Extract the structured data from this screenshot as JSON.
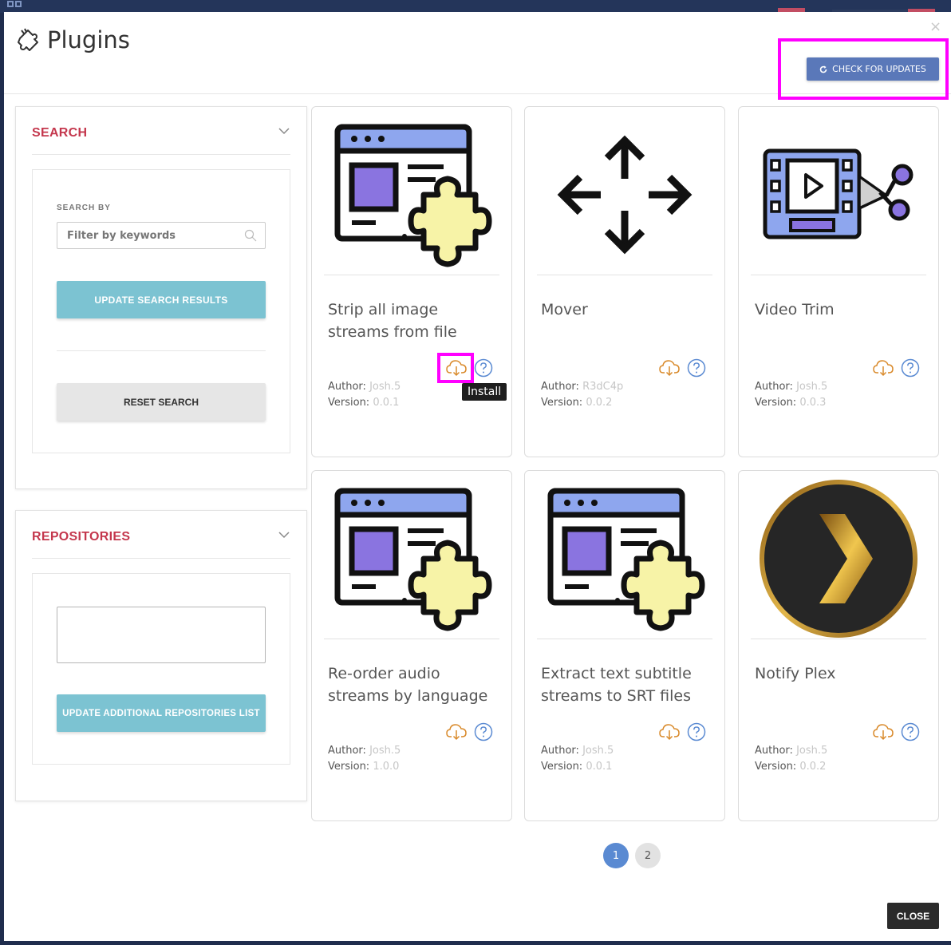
{
  "modal": {
    "title": "Plugins",
    "title_icon": "puzzle-plug-icon",
    "close_symbol": "×",
    "check_updates_label": "CHECK FOR UPDATES",
    "check_updates_icon": "refresh-icon"
  },
  "search_panel": {
    "title": "SEARCH",
    "search_by_label": "SEARCH BY",
    "search_placeholder": "Filter by keywords",
    "search_value": "",
    "update_button": "UPDATE SEARCH RESULTS",
    "reset_button": "RESET SEARCH"
  },
  "repos_panel": {
    "title": "REPOSITORIES",
    "textarea_value": "",
    "update_button": "UPDATE ADDITIONAL REPOSITORIES LIST"
  },
  "labels": {
    "author": "Author:",
    "version": "Version:"
  },
  "plugins": [
    {
      "name": "Strip all image streams from file",
      "author": "Josh.5",
      "version": "0.0.1",
      "icon": "browser-puzzle-icon"
    },
    {
      "name": "Mover",
      "author": "R3dC4p",
      "version": "0.0.2",
      "icon": "move-arrows-icon"
    },
    {
      "name": "Video Trim",
      "author": "Josh.5",
      "version": "0.0.3",
      "icon": "film-scissors-icon"
    },
    {
      "name": "Re-order audio streams by language",
      "author": "Josh.5",
      "version": "1.0.0",
      "icon": "browser-puzzle-icon"
    },
    {
      "name": "Extract text subtitle streams to SRT files",
      "author": "Josh.5",
      "version": "0.0.1",
      "icon": "browser-puzzle-icon"
    },
    {
      "name": "Notify Plex",
      "author": "Josh.5",
      "version": "0.0.2",
      "icon": "plex-logo-icon"
    }
  ],
  "tooltip": "Install",
  "pagination": [
    "1",
    "2"
  ],
  "pagination_active": "1",
  "footer": {
    "close_label": "CLOSE"
  },
  "colors": {
    "accent_red": "#c4374d",
    "teal": "#7cc3d2",
    "blue": "#5a78b9",
    "highlight": "#ff00ff",
    "install_orange": "#d98a2b",
    "help_blue": "#5a8ad2"
  }
}
